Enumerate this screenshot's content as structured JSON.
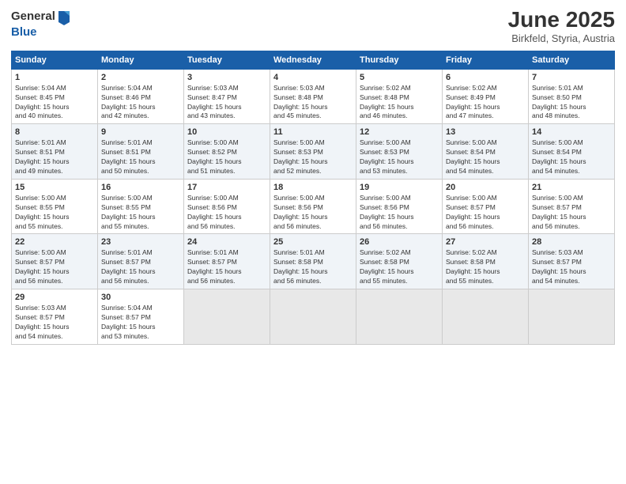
{
  "header": {
    "logo_line1": "General",
    "logo_line2": "Blue",
    "title": "June 2025",
    "location": "Birkfeld, Styria, Austria"
  },
  "calendar": {
    "days_of_week": [
      "Sunday",
      "Monday",
      "Tuesday",
      "Wednesday",
      "Thursday",
      "Friday",
      "Saturday"
    ],
    "weeks": [
      [
        {
          "num": "",
          "info": ""
        },
        {
          "num": "2",
          "info": "Sunrise: 5:04 AM\nSunset: 8:46 PM\nDaylight: 15 hours\nand 42 minutes."
        },
        {
          "num": "3",
          "info": "Sunrise: 5:03 AM\nSunset: 8:47 PM\nDaylight: 15 hours\nand 43 minutes."
        },
        {
          "num": "4",
          "info": "Sunrise: 5:03 AM\nSunset: 8:48 PM\nDaylight: 15 hours\nand 45 minutes."
        },
        {
          "num": "5",
          "info": "Sunrise: 5:02 AM\nSunset: 8:48 PM\nDaylight: 15 hours\nand 46 minutes."
        },
        {
          "num": "6",
          "info": "Sunrise: 5:02 AM\nSunset: 8:49 PM\nDaylight: 15 hours\nand 47 minutes."
        },
        {
          "num": "7",
          "info": "Sunrise: 5:01 AM\nSunset: 8:50 PM\nDaylight: 15 hours\nand 48 minutes."
        }
      ],
      [
        {
          "num": "1",
          "info": "Sunrise: 5:04 AM\nSunset: 8:45 PM\nDaylight: 15 hours\nand 40 minutes."
        },
        {
          "num": "9",
          "info": "Sunrise: 5:01 AM\nSunset: 8:51 PM\nDaylight: 15 hours\nand 50 minutes."
        },
        {
          "num": "10",
          "info": "Sunrise: 5:00 AM\nSunset: 8:52 PM\nDaylight: 15 hours\nand 51 minutes."
        },
        {
          "num": "11",
          "info": "Sunrise: 5:00 AM\nSunset: 8:53 PM\nDaylight: 15 hours\nand 52 minutes."
        },
        {
          "num": "12",
          "info": "Sunrise: 5:00 AM\nSunset: 8:53 PM\nDaylight: 15 hours\nand 53 minutes."
        },
        {
          "num": "13",
          "info": "Sunrise: 5:00 AM\nSunset: 8:54 PM\nDaylight: 15 hours\nand 54 minutes."
        },
        {
          "num": "14",
          "info": "Sunrise: 5:00 AM\nSunset: 8:54 PM\nDaylight: 15 hours\nand 54 minutes."
        }
      ],
      [
        {
          "num": "8",
          "info": "Sunrise: 5:01 AM\nSunset: 8:51 PM\nDaylight: 15 hours\nand 49 minutes."
        },
        {
          "num": "16",
          "info": "Sunrise: 5:00 AM\nSunset: 8:55 PM\nDaylight: 15 hours\nand 55 minutes."
        },
        {
          "num": "17",
          "info": "Sunrise: 5:00 AM\nSunset: 8:56 PM\nDaylight: 15 hours\nand 56 minutes."
        },
        {
          "num": "18",
          "info": "Sunrise: 5:00 AM\nSunset: 8:56 PM\nDaylight: 15 hours\nand 56 minutes."
        },
        {
          "num": "19",
          "info": "Sunrise: 5:00 AM\nSunset: 8:56 PM\nDaylight: 15 hours\nand 56 minutes."
        },
        {
          "num": "20",
          "info": "Sunrise: 5:00 AM\nSunset: 8:57 PM\nDaylight: 15 hours\nand 56 minutes."
        },
        {
          "num": "21",
          "info": "Sunrise: 5:00 AM\nSunset: 8:57 PM\nDaylight: 15 hours\nand 56 minutes."
        }
      ],
      [
        {
          "num": "15",
          "info": "Sunrise: 5:00 AM\nSunset: 8:55 PM\nDaylight: 15 hours\nand 55 minutes."
        },
        {
          "num": "23",
          "info": "Sunrise: 5:01 AM\nSunset: 8:57 PM\nDaylight: 15 hours\nand 56 minutes."
        },
        {
          "num": "24",
          "info": "Sunrise: 5:01 AM\nSunset: 8:57 PM\nDaylight: 15 hours\nand 56 minutes."
        },
        {
          "num": "25",
          "info": "Sunrise: 5:01 AM\nSunset: 8:58 PM\nDaylight: 15 hours\nand 56 minutes."
        },
        {
          "num": "26",
          "info": "Sunrise: 5:02 AM\nSunset: 8:58 PM\nDaylight: 15 hours\nand 55 minutes."
        },
        {
          "num": "27",
          "info": "Sunrise: 5:02 AM\nSunset: 8:58 PM\nDaylight: 15 hours\nand 55 minutes."
        },
        {
          "num": "28",
          "info": "Sunrise: 5:03 AM\nSunset: 8:57 PM\nDaylight: 15 hours\nand 54 minutes."
        }
      ],
      [
        {
          "num": "22",
          "info": "Sunrise: 5:00 AM\nSunset: 8:57 PM\nDaylight: 15 hours\nand 56 minutes."
        },
        {
          "num": "30",
          "info": "Sunrise: 5:04 AM\nSunset: 8:57 PM\nDaylight: 15 hours\nand 53 minutes."
        },
        {
          "num": "",
          "info": ""
        },
        {
          "num": "",
          "info": ""
        },
        {
          "num": "",
          "info": ""
        },
        {
          "num": "",
          "info": ""
        },
        {
          "num": "",
          "info": ""
        }
      ],
      [
        {
          "num": "29",
          "info": "Sunrise: 5:03 AM\nSunset: 8:57 PM\nDaylight: 15 hours\nand 54 minutes."
        },
        {
          "num": "",
          "info": ""
        },
        {
          "num": "",
          "info": ""
        },
        {
          "num": "",
          "info": ""
        },
        {
          "num": "",
          "info": ""
        },
        {
          "num": "",
          "info": ""
        },
        {
          "num": "",
          "info": ""
        }
      ]
    ]
  }
}
